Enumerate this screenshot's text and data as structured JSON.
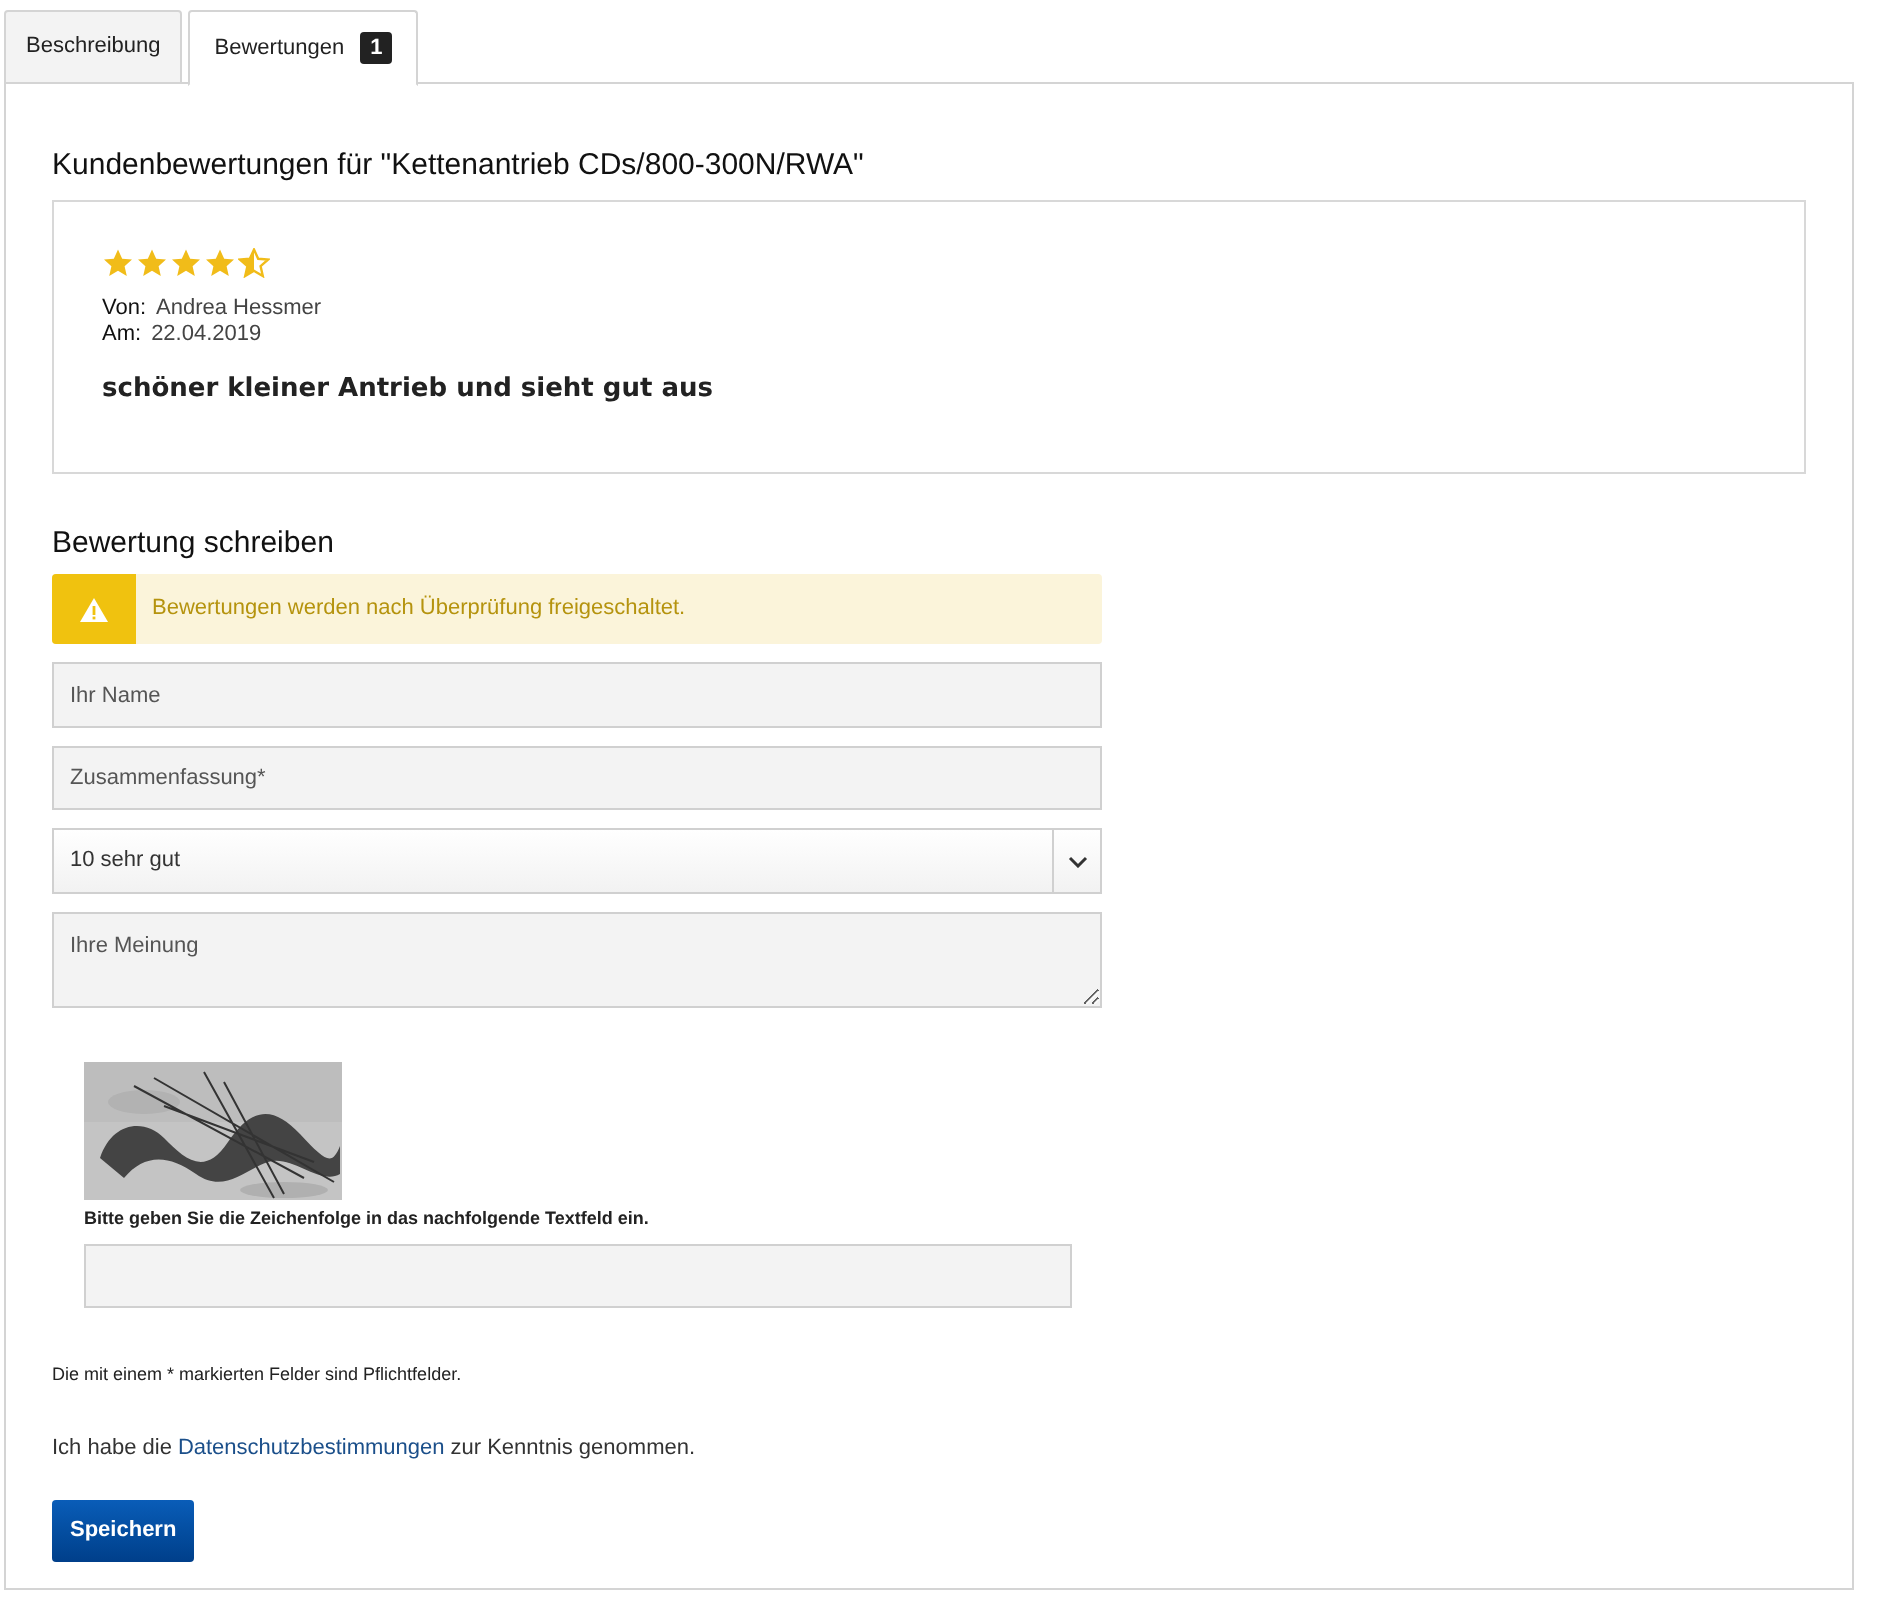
{
  "tabs": [
    {
      "label": "Beschreibung",
      "selected": false
    },
    {
      "label": "Bewertungen",
      "badge": "1",
      "selected": true
    }
  ],
  "reviews_title": "Kundenbewertungen für \"Kettenantrieb CDs/800-300N/RWA\"",
  "reviews": [
    {
      "stars": 4.5,
      "author_label": "Von:",
      "author": "Andrea Hessmer",
      "date_label": "Am:",
      "date": "22.04.2019",
      "headline": "schöner kleiner Antrieb und sieht gut aus"
    }
  ],
  "form": {
    "title": "Bewertung schreiben",
    "notice": "Bewertungen werden nach Überprüfung freigeschaltet.",
    "name_field": {
      "placeholder": "Ihr Name"
    },
    "summary_field": {
      "placeholder": "Zusammenfassung*"
    },
    "rating_select": {
      "value": "10 sehr gut"
    },
    "opinion_field": {
      "placeholder": "Ihre Meinung"
    },
    "captcha": {
      "hint": "Bitte geben Sie die Zeichenfolge in das nachfolgende Textfeld ein."
    },
    "required_note": "Die mit einem * markierten Felder sind Pflichtfelder.",
    "privacy": {
      "before": "Ich habe die",
      "link": "Datenschutzbestimmungen",
      "after": "zur Kenntnis genommen."
    },
    "submit": "Speichern"
  }
}
